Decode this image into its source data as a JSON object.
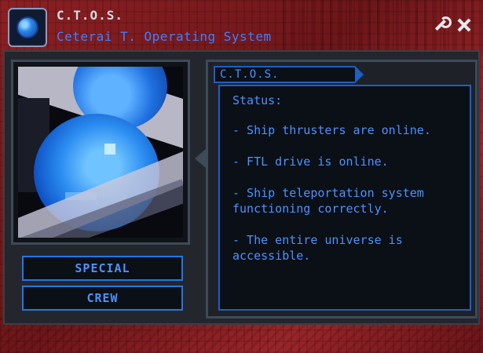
{
  "header": {
    "title": "C.T.O.S.",
    "subtitle": "Ceterai T. Operating System",
    "icons": [
      "app-icon",
      "wrench-icon",
      "close-icon"
    ]
  },
  "side_buttons": [
    {
      "label": "SPECIAL"
    },
    {
      "label": "CREW"
    }
  ],
  "info": {
    "tab_label": "C.T.O.S.",
    "status_heading": "Status:",
    "status_items": [
      "- Ship thrusters are online.",
      "- FTL drive is online.",
      "- Ship teleportation system functioning correctly.",
      "- The entire universe is accessible."
    ]
  },
  "colors": {
    "accent_blue": "#4a93ff",
    "frame_gray": "#3f4a58",
    "background_red": "#7a1a1d"
  }
}
